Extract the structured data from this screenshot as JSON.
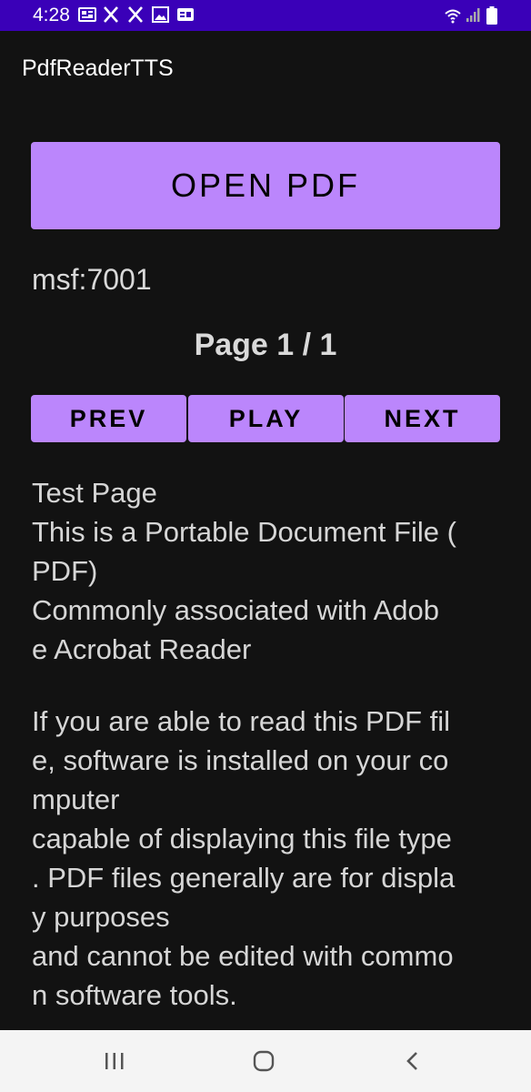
{
  "status_bar": {
    "time": "4:28",
    "left_icons": [
      "newspaper-icon",
      "x-logo-icon",
      "x-logo-icon",
      "image-icon",
      "g-news-icon"
    ],
    "right_icons": [
      "wifi-icon",
      "cellular-signal-icon",
      "battery-icon"
    ],
    "background": "#3a00b8"
  },
  "app_bar": {
    "title": "PdfReaderTTS"
  },
  "main": {
    "open_button_label": "OPEN PDF",
    "file_uri": "msf:7001",
    "page_indicator": "Page 1 / 1",
    "nav": {
      "prev_label": "PREV",
      "play_label": "PLAY",
      "next_label": "NEXT"
    },
    "pdf_lines": [
      "Test Page",
      "This is a Portable Document File (",
      "PDF)",
      "Commonly associated with Adob",
      "e Acrobat Reader",
      "",
      "If you are able to read this PDF fil",
      "e, software is installed on your co",
      "mputer",
      "capable of displaying this file type",
      ". PDF files generally are for displa",
      "y purposes",
      "and cannot be edited with commo",
      "n software tools."
    ]
  },
  "system_nav": {
    "icons": [
      "recents-icon",
      "home-icon",
      "back-icon"
    ]
  },
  "colors": {
    "accent": "#bb86fc",
    "background": "#121212",
    "text": "#d9d9d9"
  }
}
